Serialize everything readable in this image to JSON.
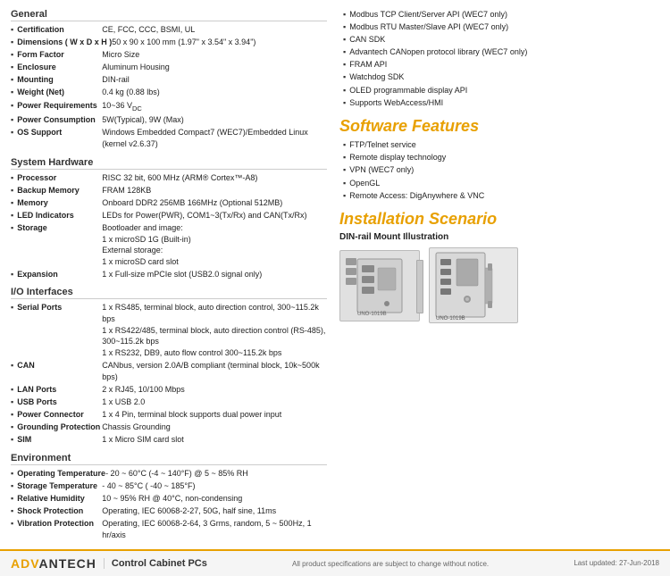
{
  "page": {
    "sections": {
      "general": {
        "title": "General",
        "items": [
          {
            "label": "Certification",
            "value": "CE, FCC, CCC, BSMI, UL"
          },
          {
            "label": "Dimensions ( W x D x H )",
            "value": "50 x 90 x 100 mm (1.97\" x 3.54\" x 3.94\")"
          },
          {
            "label": "Form Factor",
            "value": "Micro Size"
          },
          {
            "label": "Enclosure",
            "value": "Aluminum Housing"
          },
          {
            "label": "Mounting",
            "value": "DIN-rail"
          },
          {
            "label": "Weight (Net)",
            "value": "0.4 kg (0.88 lbs)"
          },
          {
            "label": "Power Requirements",
            "value": "10~36 VDC"
          },
          {
            "label": "Power Consumption",
            "value": "5W(Typical), 9W (Max)"
          },
          {
            "label": "OS Support",
            "value": "Windows Embedded Compact7 (WEC7)/Embedded Linux (kernel v2.6.37)"
          }
        ]
      },
      "system_hardware": {
        "title": "System Hardware",
        "items": [
          {
            "label": "Processor",
            "value": "RISC 32 bit, 600 MHz (ARM® Cortex™-A8)"
          },
          {
            "label": "Backup Memory",
            "value": "FRAM 128KB"
          },
          {
            "label": "Memory",
            "value": "Onboard DDR2 256MB 166MHz (Optional 512MB)"
          },
          {
            "label": "LED Indicators",
            "value": "LEDs for Power(PWR), COM1~3(Tx/Rx) and CAN(Tx/Rx)"
          },
          {
            "label": "Storage",
            "value": "Bootloader and image:\n1 x microSD 1G (Built-in)\nExternal storage:\n1 x microSD card slot"
          },
          {
            "label": "Expansion",
            "value": "1 x Full-size mPCIe slot (USB2.0 signal only)"
          }
        ]
      },
      "io_interfaces": {
        "title": "I/O Interfaces",
        "items": [
          {
            "label": "Serial Ports",
            "value": "1 x RS485, terminal block, auto direction control, 300~115.2k bps\n1 x RS422/485, terminal block, auto direction control (RS-485), 300~115.2k bps\n1 x RS232, DB9, auto flow control 300~115.2k bps"
          },
          {
            "label": "CAN",
            "value": "CANbus, version 2.0A/B compliant (terminal block, 10k~500k bps)"
          },
          {
            "label": "LAN Ports",
            "value": "2 x RJ45, 10/100 Mbps"
          },
          {
            "label": "USB Ports",
            "value": "1 x USB 2.0"
          },
          {
            "label": "Power Connector",
            "value": "1 x 4 Pin, terminal block supports dual power input"
          },
          {
            "label": "Grounding Protection",
            "value": "Chassis Grounding"
          },
          {
            "label": "SIM",
            "value": "1 x Micro SIM card slot"
          }
        ]
      },
      "environment": {
        "title": "Environment",
        "items": [
          {
            "label": "Operating Temperature",
            "value": "- 20 ~ 60°C (-4 ~ 140°F) @ 5 ~ 85% RH"
          },
          {
            "label": "Storage Temperature",
            "value": "- 40 ~ 85°C ( -40 ~ 185°F)"
          },
          {
            "label": "Relative Humidity",
            "value": "10 ~ 95% RH @ 40°C, non-condensing"
          },
          {
            "label": "Shock Protection",
            "value": "Operating, IEC 60068-2-27, 50G, half sine, 11ms"
          },
          {
            "label": "Vibration Protection",
            "value": "Operating, IEC 60068-2-64, 3 Grms, random, 5 ~ 500Hz, 1 hr/axis"
          }
        ]
      }
    },
    "right": {
      "api_bullets": [
        "Modbus TCP Client/Server API (WEC7 only)",
        "Modbus RTU Master/Slave API (WEC7 only)",
        "CAN SDK",
        "Advantech CANopen protocol library (WEC7 only)",
        "FRAM API",
        "Watchdog SDK",
        "OLED programmable display API",
        "Supports WebAccess/HMI"
      ],
      "software_features": {
        "title": "Software Features",
        "items": [
          "FTP/Telnet service",
          "Remote display technology",
          "VPN (WEC7 only)",
          "OpenGL",
          "Remote Access: DigAnywhere & VNC"
        ]
      },
      "installation": {
        "title": "Installation Scenario",
        "subtitle": "DIN-rail Mount Illustration"
      }
    },
    "footer": {
      "brand": "ADVANTECH",
      "category": "Control Cabinet PCs",
      "note": "All product specifications are subject to change without notice.",
      "date": "Last updated: 27-Jun-2018"
    }
  }
}
